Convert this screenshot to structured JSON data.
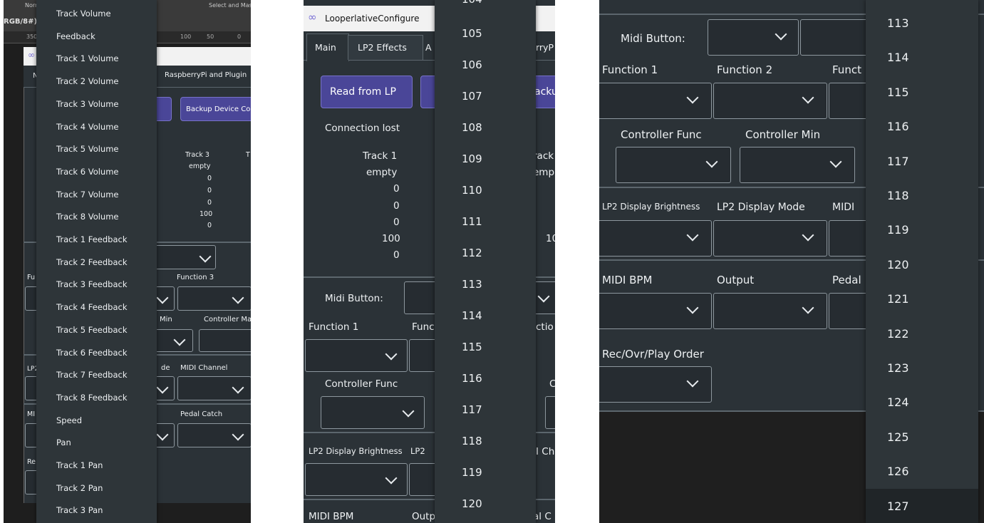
{
  "panel1": {
    "bg_strip": {
      "label_a": "Norm",
      "label_b": "RGB/8#)",
      "label_c": "Select and Mask...",
      "ruler": [
        "350",
        "100",
        "50",
        "0"
      ]
    },
    "window": {
      "tab_partial": "N",
      "tab_raspberry": "RaspberryPi and Plugin",
      "backup_button": "Backup Device Co",
      "track_col_label": "Track 3",
      "track_col_next": "T",
      "track_values": [
        "empty",
        "0",
        "0",
        "0",
        "100",
        "0"
      ],
      "func_partial": "Fu",
      "function3_label": "Function 3",
      "min_label": "Min",
      "controller_max_label": "Controller Ma",
      "lp_partial": "LP2",
      "mode_partial": "de",
      "midi_channel_label": "MIDI Channel",
      "mi_partial": "MI",
      "pedal_catch_label": "Pedal Catch",
      "re_partial": "Re"
    },
    "menu_items": [
      "Track Volume",
      "Feedback",
      "Track 1 Volume",
      "Track 2 Volume",
      "Track 3 Volume",
      "Track 4 Volume",
      "Track 5 Volume",
      "Track 6 Volume",
      "Track 7 Volume",
      "Track 8 Volume",
      "Track 1 Feedback",
      "Track 2 Feedback",
      "Track 3 Feedback",
      "Track 4 Feedback",
      "Track 5 Feedback",
      "Track 6 Feedback",
      "Track 7 Feedback",
      "Track 8 Feedback",
      "Speed",
      "Pan",
      "Track 1 Pan",
      "Track 2 Pan",
      "Track 3 Pan"
    ]
  },
  "panel2": {
    "title": "LooperlativeConfigure",
    "tabs": [
      "Main",
      "LP2 Effects",
      "A"
    ],
    "tab_right_partial": "rryP",
    "read_button": "Read from LP",
    "backup_partial": "acku",
    "connection_status": "Connection lost",
    "track_label": "Track 1",
    "track_values": [
      "empty",
      "0",
      "0",
      "0",
      "100",
      "0"
    ],
    "track_right_partial": "rack",
    "track_right_value": "emp",
    "track_right_100": "10",
    "midi_button_label": "Midi Button:",
    "function1_label": "Function 1",
    "func_partial": "Func",
    "ction_partial": "ctio",
    "controller_func_label": "Controller Func",
    "c_partial": "C",
    "lp2_brightness_label": "LP2 Display Brightness",
    "lp2_partial": "LP2",
    "i_ch_partial": "I Ch",
    "midi_bpm_label": "MIDI BPM",
    "outp_partial": "Outp",
    "al_c_partial": "al C",
    "list_top_partial": "104",
    "list": [
      "105",
      "106",
      "107",
      "108",
      "109",
      "110",
      "111",
      "112",
      "113",
      "114",
      "115",
      "116",
      "117",
      "118",
      "119",
      "120"
    ]
  },
  "panel3": {
    "midi_button_label": "Midi Button:",
    "function1_label": "Function 1",
    "function2_label": "Function 2",
    "funct_partial": "Funct",
    "controller_func_label": "Controller Func",
    "controller_min_label": "Controller Min",
    "lp2_brightness_label": "LP2 Display Brightness",
    "lp2_mode_label": "LP2 Display Mode",
    "midi_partial": "MIDI",
    "midi_bpm_label": "MIDI BPM",
    "output_label": "Output",
    "pedal_partial": "Pedal",
    "rec_order_label": "Rec/Ovr/Play Order",
    "list": [
      "113",
      "114",
      "115",
      "116",
      "117",
      "118",
      "119",
      "120",
      "121",
      "122",
      "123",
      "124",
      "125",
      "126",
      "127"
    ],
    "selected_value": "127"
  }
}
